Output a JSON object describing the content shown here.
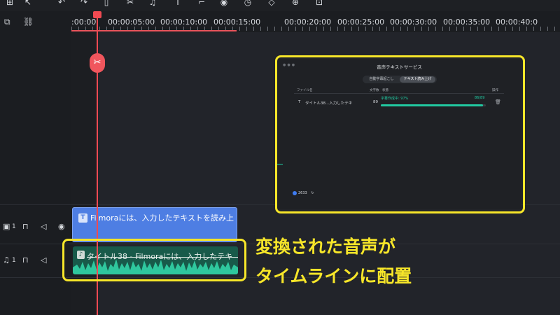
{
  "toolbar": {
    "icons": [
      "grid-icon",
      "select-tool-icon",
      "undo-icon",
      "redo-icon",
      "delete-icon",
      "cut-icon",
      "audio-icon",
      "text-icon",
      "crop-icon",
      "color-icon",
      "speed-icon",
      "keyframe-icon",
      "ai-icon",
      "more-icon"
    ]
  },
  "ruler": {
    "labels": [
      ":00:00",
      "00:00:05:00",
      "00:00:10:00",
      "00:00:15:00",
      "00:00:20:00",
      "00:00:25:00",
      "00:00:30:00",
      "00:00:35:00",
      "00:00:40:0"
    ]
  },
  "tracks": {
    "text_track_num": "1",
    "audio_track_num": "1"
  },
  "clips": {
    "text_clip_label": "Filmoraには、入力したテキストを読み上げ…",
    "audio_clip_label": "タイトル38 - Filmoraには、入力したテキ"
  },
  "callout": {
    "line1": "変換された音声が",
    "line2": "タイムラインに配置"
  },
  "dialog": {
    "title": "音声テキストサービス",
    "tabs": [
      "自動字幕起こし",
      "テキスト読み上げ"
    ],
    "active_tab": 1,
    "columns": [
      "ファイル名",
      "文字数",
      "状態",
      "操作"
    ],
    "row": {
      "file_name": "タイトル38...入力したテキ",
      "char_count": "89",
      "status_label": "字幕作成中: 97%",
      "status_count": "86/89",
      "progress": 0.97
    },
    "credits": "2633"
  },
  "colors": {
    "playhead": "#f04a52",
    "highlight": "#f7e629",
    "text_clip": "#4e7ee3",
    "audio_clip": "#185a4a",
    "progress": "#21c9a1"
  }
}
